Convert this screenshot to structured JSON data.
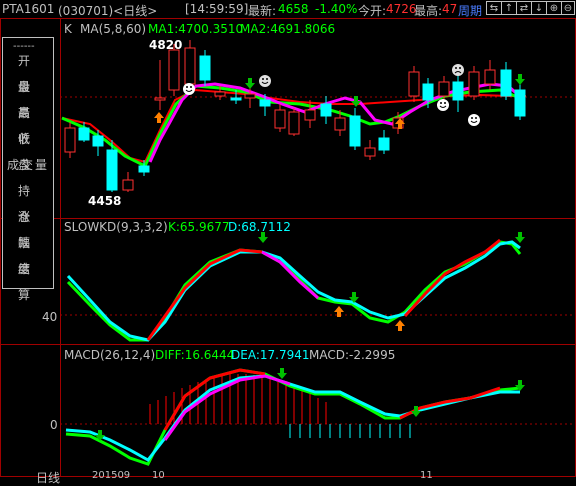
{
  "topbar": {
    "symbol": "PTA1601",
    "code_period": "(030701)<日线>",
    "time": "[14:59:59]",
    "latest_label": "最新:",
    "latest_value": "4658",
    "change_pct": "-1.40%",
    "open_label": "今开:",
    "open_value": "4726",
    "high_label": "最高:",
    "high_value": "47",
    "period_label": "周期",
    "nav_buttons": [
      "⇆",
      "↑",
      "⇄",
      "↓",
      "⊕",
      "⊖"
    ]
  },
  "sidebar": {
    "items": [
      "开盘",
      "最高",
      "最低",
      "收盘",
      "成交量",
      "持仓",
      "涨跌",
      "幅度",
      "结算"
    ]
  },
  "main_chart": {
    "k_label": "K",
    "ma_label": "MA(5,8,60)",
    "ma1": "MA1:4700.3510",
    "ma2": "MA2:4691.8066",
    "high_marker": "4820",
    "low_marker": "4458"
  },
  "kd_chart": {
    "label": "SLOWKD(9,3,3,2)",
    "k_value": "K:65.9677",
    "d_value": "D:68.7112",
    "axis_tick": "40"
  },
  "macd_chart": {
    "label": "MACD(26,12,4)",
    "diff": "DIFF:16.6444",
    "dea": "DEA:17.7941",
    "macd": "MACD:-2.2995",
    "axis_tick": "0"
  },
  "bottom": {
    "period_cn": "日线",
    "date_left": "201509",
    "tick_mid": "10",
    "tick_right": "11"
  },
  "colors": {
    "up": "#ff3030",
    "down": "#00ffff",
    "ma_green": "#00ff00",
    "ma_magenta": "#ff00ff",
    "ma_red": "#ff0000",
    "grid": "#a00000",
    "yellow": "#ffff00",
    "white": "#ffffff"
  }
}
